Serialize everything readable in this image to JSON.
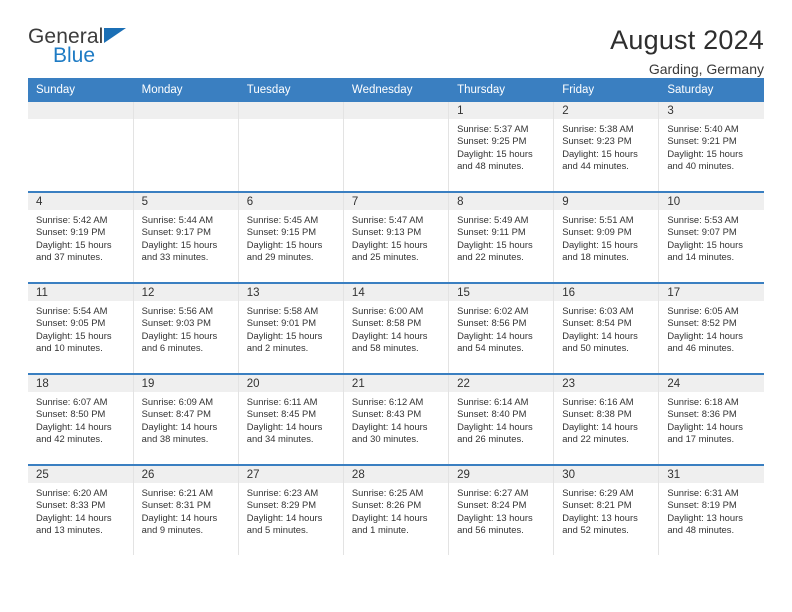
{
  "logo": {
    "word_one": "General",
    "word_two": "Blue",
    "triangle_color": "#1b6fb5",
    "blue_color": "#1e7bc4"
  },
  "header": {
    "title": "August 2024",
    "subtitle": "Garding, Germany",
    "accent_color": "#3a7fc1"
  },
  "weekday_headers": [
    "Sunday",
    "Monday",
    "Tuesday",
    "Wednesday",
    "Thursday",
    "Friday",
    "Saturday"
  ],
  "labels": {
    "sunrise_prefix": "Sunrise:",
    "sunset_prefix": "Sunset:",
    "daylight_prefix": "Daylight:"
  },
  "weeks": [
    [
      {
        "day": "",
        "empty": true
      },
      {
        "day": "",
        "empty": true
      },
      {
        "day": "",
        "empty": true
      },
      {
        "day": "",
        "empty": true
      },
      {
        "day": "1",
        "sunrise": "Sunrise: 5:37 AM",
        "sunset": "Sunset: 9:25 PM",
        "daylight": "Daylight: 15 hours and 48 minutes."
      },
      {
        "day": "2",
        "sunrise": "Sunrise: 5:38 AM",
        "sunset": "Sunset: 9:23 PM",
        "daylight": "Daylight: 15 hours and 44 minutes."
      },
      {
        "day": "3",
        "sunrise": "Sunrise: 5:40 AM",
        "sunset": "Sunset: 9:21 PM",
        "daylight": "Daylight: 15 hours and 40 minutes."
      }
    ],
    [
      {
        "day": "4",
        "sunrise": "Sunrise: 5:42 AM",
        "sunset": "Sunset: 9:19 PM",
        "daylight": "Daylight: 15 hours and 37 minutes."
      },
      {
        "day": "5",
        "sunrise": "Sunrise: 5:44 AM",
        "sunset": "Sunset: 9:17 PM",
        "daylight": "Daylight: 15 hours and 33 minutes."
      },
      {
        "day": "6",
        "sunrise": "Sunrise: 5:45 AM",
        "sunset": "Sunset: 9:15 PM",
        "daylight": "Daylight: 15 hours and 29 minutes."
      },
      {
        "day": "7",
        "sunrise": "Sunrise: 5:47 AM",
        "sunset": "Sunset: 9:13 PM",
        "daylight": "Daylight: 15 hours and 25 minutes."
      },
      {
        "day": "8",
        "sunrise": "Sunrise: 5:49 AM",
        "sunset": "Sunset: 9:11 PM",
        "daylight": "Daylight: 15 hours and 22 minutes."
      },
      {
        "day": "9",
        "sunrise": "Sunrise: 5:51 AM",
        "sunset": "Sunset: 9:09 PM",
        "daylight": "Daylight: 15 hours and 18 minutes."
      },
      {
        "day": "10",
        "sunrise": "Sunrise: 5:53 AM",
        "sunset": "Sunset: 9:07 PM",
        "daylight": "Daylight: 15 hours and 14 minutes."
      }
    ],
    [
      {
        "day": "11",
        "sunrise": "Sunrise: 5:54 AM",
        "sunset": "Sunset: 9:05 PM",
        "daylight": "Daylight: 15 hours and 10 minutes."
      },
      {
        "day": "12",
        "sunrise": "Sunrise: 5:56 AM",
        "sunset": "Sunset: 9:03 PM",
        "daylight": "Daylight: 15 hours and 6 minutes."
      },
      {
        "day": "13",
        "sunrise": "Sunrise: 5:58 AM",
        "sunset": "Sunset: 9:01 PM",
        "daylight": "Daylight: 15 hours and 2 minutes."
      },
      {
        "day": "14",
        "sunrise": "Sunrise: 6:00 AM",
        "sunset": "Sunset: 8:58 PM",
        "daylight": "Daylight: 14 hours and 58 minutes."
      },
      {
        "day": "15",
        "sunrise": "Sunrise: 6:02 AM",
        "sunset": "Sunset: 8:56 PM",
        "daylight": "Daylight: 14 hours and 54 minutes."
      },
      {
        "day": "16",
        "sunrise": "Sunrise: 6:03 AM",
        "sunset": "Sunset: 8:54 PM",
        "daylight": "Daylight: 14 hours and 50 minutes."
      },
      {
        "day": "17",
        "sunrise": "Sunrise: 6:05 AM",
        "sunset": "Sunset: 8:52 PM",
        "daylight": "Daylight: 14 hours and 46 minutes."
      }
    ],
    [
      {
        "day": "18",
        "sunrise": "Sunrise: 6:07 AM",
        "sunset": "Sunset: 8:50 PM",
        "daylight": "Daylight: 14 hours and 42 minutes."
      },
      {
        "day": "19",
        "sunrise": "Sunrise: 6:09 AM",
        "sunset": "Sunset: 8:47 PM",
        "daylight": "Daylight: 14 hours and 38 minutes."
      },
      {
        "day": "20",
        "sunrise": "Sunrise: 6:11 AM",
        "sunset": "Sunset: 8:45 PM",
        "daylight": "Daylight: 14 hours and 34 minutes."
      },
      {
        "day": "21",
        "sunrise": "Sunrise: 6:12 AM",
        "sunset": "Sunset: 8:43 PM",
        "daylight": "Daylight: 14 hours and 30 minutes."
      },
      {
        "day": "22",
        "sunrise": "Sunrise: 6:14 AM",
        "sunset": "Sunset: 8:40 PM",
        "daylight": "Daylight: 14 hours and 26 minutes."
      },
      {
        "day": "23",
        "sunrise": "Sunrise: 6:16 AM",
        "sunset": "Sunset: 8:38 PM",
        "daylight": "Daylight: 14 hours and 22 minutes."
      },
      {
        "day": "24",
        "sunrise": "Sunrise: 6:18 AM",
        "sunset": "Sunset: 8:36 PM",
        "daylight": "Daylight: 14 hours and 17 minutes."
      }
    ],
    [
      {
        "day": "25",
        "sunrise": "Sunrise: 6:20 AM",
        "sunset": "Sunset: 8:33 PM",
        "daylight": "Daylight: 14 hours and 13 minutes."
      },
      {
        "day": "26",
        "sunrise": "Sunrise: 6:21 AM",
        "sunset": "Sunset: 8:31 PM",
        "daylight": "Daylight: 14 hours and 9 minutes."
      },
      {
        "day": "27",
        "sunrise": "Sunrise: 6:23 AM",
        "sunset": "Sunset: 8:29 PM",
        "daylight": "Daylight: 14 hours and 5 minutes."
      },
      {
        "day": "28",
        "sunrise": "Sunrise: 6:25 AM",
        "sunset": "Sunset: 8:26 PM",
        "daylight": "Daylight: 14 hours and 1 minute."
      },
      {
        "day": "29",
        "sunrise": "Sunrise: 6:27 AM",
        "sunset": "Sunset: 8:24 PM",
        "daylight": "Daylight: 13 hours and 56 minutes."
      },
      {
        "day": "30",
        "sunrise": "Sunrise: 6:29 AM",
        "sunset": "Sunset: 8:21 PM",
        "daylight": "Daylight: 13 hours and 52 minutes."
      },
      {
        "day": "31",
        "sunrise": "Sunrise: 6:31 AM",
        "sunset": "Sunset: 8:19 PM",
        "daylight": "Daylight: 13 hours and 48 minutes."
      }
    ]
  ]
}
